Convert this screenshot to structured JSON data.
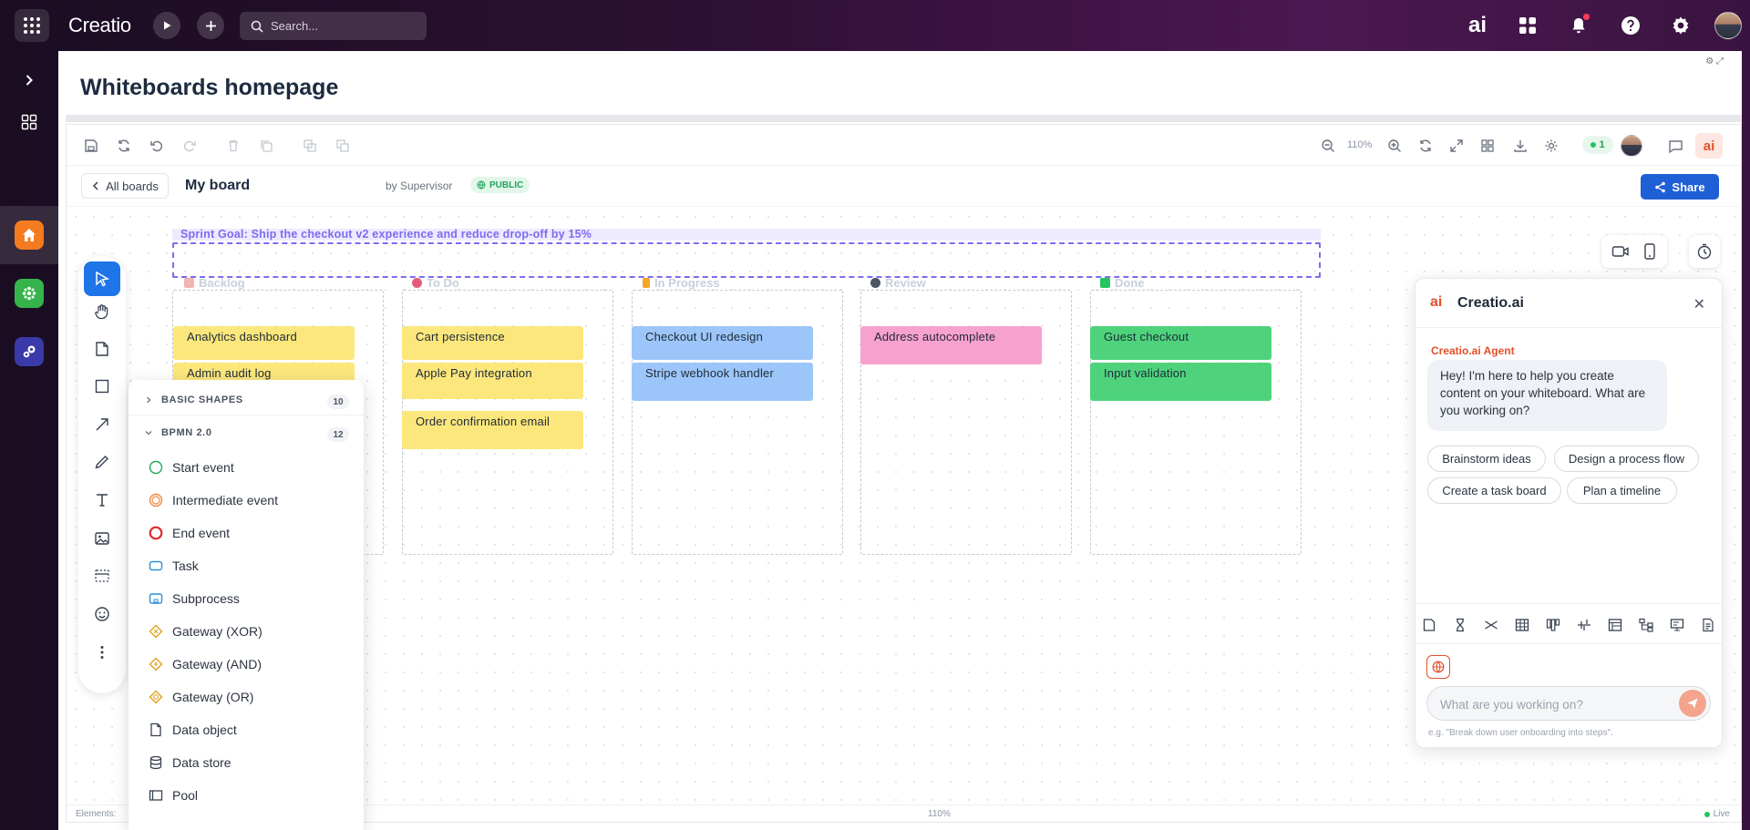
{
  "app": {
    "logo": "Creatio",
    "search_placeholder": "Search...",
    "ai_label": "ai"
  },
  "page": {
    "title": "Whiteboards homepage"
  },
  "toolbar": {
    "zoom": "110%",
    "online_count": "1",
    "ai_label": "ai"
  },
  "board": {
    "back_label": "All boards",
    "name": "My board",
    "owner": "by Supervisor",
    "visibility": "PUBLIC",
    "share_label": "Share",
    "goal": "Sprint Goal: Ship the checkout v2 experience and reduce drop-off by 15%"
  },
  "columns": [
    {
      "title": "Backlog",
      "color": "#f2a0a0",
      "cards": [
        {
          "text": "Analytics dashboard",
          "color": "#fbe77c"
        },
        {
          "text": "Admin audit log",
          "color": "#fbe77c"
        }
      ]
    },
    {
      "title": "To Do",
      "color": "#e45a7a",
      "cards": [
        {
          "text": "Cart persistence",
          "color": "#fbe77c"
        },
        {
          "text": "Apple Pay integration",
          "color": "#fbe77c"
        },
        {
          "text": "Order confirmation email",
          "color": "#fbe77c"
        }
      ]
    },
    {
      "title": "In Progress",
      "color": "#f5a524",
      "cards": [
        {
          "text": "Checkout UI redesign",
          "color": "#9cc6f9"
        },
        {
          "text": "Stripe webhook handler",
          "color": "#9cc6f9"
        }
      ]
    },
    {
      "title": "Review",
      "color": "#4b5563",
      "cards": [
        {
          "text": "Address autocomplete",
          "color": "#f7a1cf"
        }
      ]
    },
    {
      "title": "Done",
      "color": "#22c55e",
      "cards": [
        {
          "text": "Guest checkout",
          "color": "#4ed37c"
        },
        {
          "text": "Input validation",
          "color": "#4ed37c"
        }
      ]
    }
  ],
  "shape_panel": {
    "sections": [
      {
        "label": "BASIC SHAPES",
        "count": "10",
        "expanded": false
      },
      {
        "label": "BPMN 2.0",
        "count": "12",
        "expanded": true
      }
    ],
    "items": [
      "Start event",
      "Intermediate event",
      "End event",
      "Task",
      "Subprocess",
      "Gateway (XOR)",
      "Gateway (AND)",
      "Gateway (OR)",
      "Data object",
      "Data store",
      "Pool"
    ]
  },
  "ai_panel": {
    "title": "Creatio.ai",
    "agent_label": "Creatio.ai Agent",
    "greeting": "Hey! I'm here to help you create content on your whiteboard. What are you working on?",
    "suggestions": [
      "Brainstorm ideas",
      "Design a process flow",
      "Create a task board",
      "Plan a timeline"
    ],
    "input_placeholder": "What are you working on?",
    "hint": "e.g. \"Break down user onboarding into steps\"."
  },
  "footer": {
    "elements_label": "Elements:",
    "zoom": "110%",
    "status": "Live"
  },
  "colors": {
    "accent": "#1f5fd6",
    "ai_orange": "#e3502a",
    "goal_purple": "#7c6cf0"
  }
}
